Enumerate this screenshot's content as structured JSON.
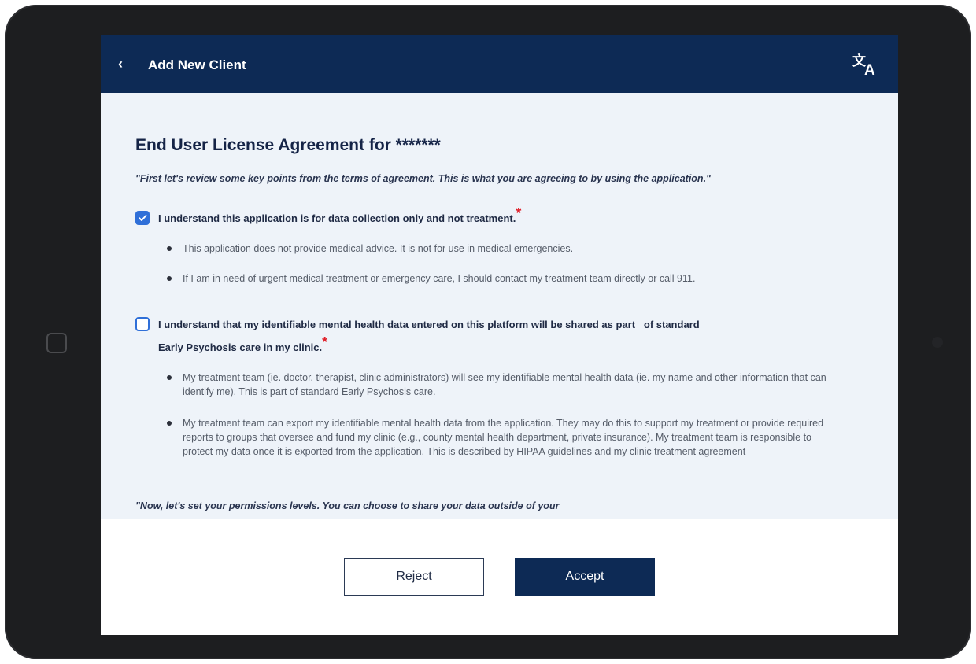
{
  "header": {
    "back_icon": "chevron-left-icon",
    "title": "Add New Client",
    "translate_icon": "translate-icon"
  },
  "agreement": {
    "title": "End User License Agreement for *******",
    "intro": "\"First let's review some key points from the terms of agreement. This is what you are agreeing to by using the application.\"",
    "items": [
      {
        "checked": true,
        "text_line1": "I understand this application is for data collection only and not treatment.",
        "text_line2": "",
        "required_mark": "*",
        "bullets": [
          "This application does not provide medical advice. It is not for use in medical emergencies.",
          "If I am in need of urgent medical treatment or emergency care, I should contact my treatment team directly or call 911."
        ]
      },
      {
        "checked": false,
        "text_line1": "I understand that my identifiable mental health data entered on this platform will be shared as part   of standard",
        "text_line2": "Early Psychosis care in my clinic.",
        "required_mark": "*",
        "bullets": [
          "My treatment team (ie. doctor, therapist, clinic administrators) will see my identifiable mental health data (ie. my name and other information that can identify me). This is part of standard Early Psychosis care.",
          "My treatment team can export my identifiable mental health data from the application. They may do this to support my treatment or provide required reports to groups that oversee and fund my clinic (e.g., county mental health department, private insurance). My treatment team is responsible to protect my data once it is exported from the application. This is described by HIPAA guidelines and my clinic treatment agreement"
        ]
      }
    ],
    "outro": "\"Now, let's set your permissions levels. You can choose to share your data outside of your"
  },
  "footer": {
    "reject_label": "Reject",
    "accept_label": "Accept"
  },
  "colors": {
    "header_bg": "#0d2a55",
    "accent": "#2f6fd8",
    "required": "#e0202a"
  }
}
